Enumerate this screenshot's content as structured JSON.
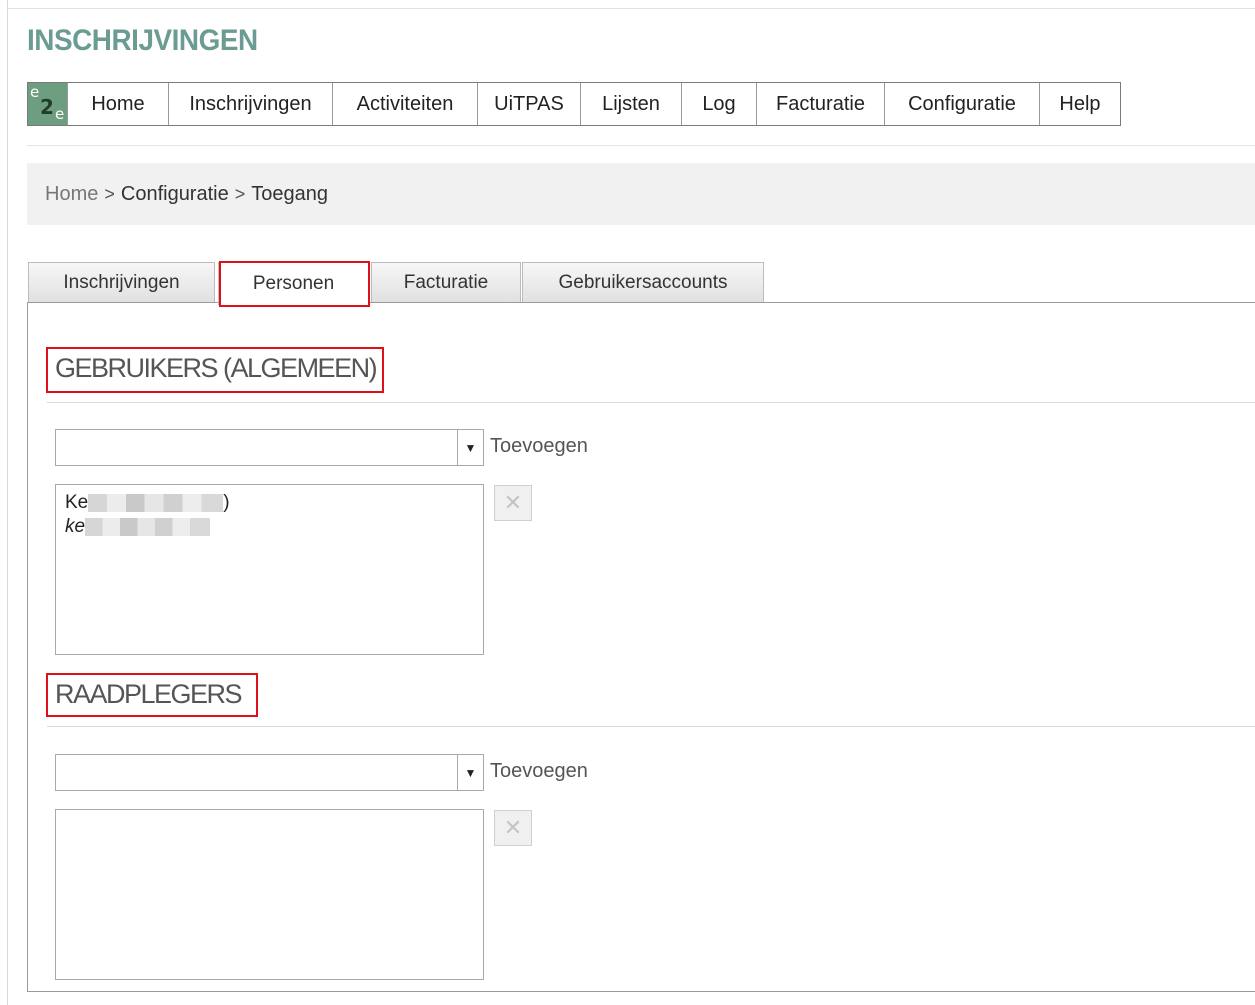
{
  "app": {
    "title": "INSCHRIJVINGEN"
  },
  "menu": {
    "logo_text": [
      "e",
      "2",
      "e"
    ],
    "items": [
      "Home",
      "Inschrijvingen",
      "Activiteiten",
      "UiTPAS",
      "Lijsten",
      "Log",
      "Facturatie",
      "Configuratie",
      "Help"
    ]
  },
  "breadcrumb": {
    "items": [
      "Home",
      "Configuratie",
      "Toegang"
    ],
    "separator": ">"
  },
  "tabs": {
    "items": [
      "Inschrijvingen",
      "Personen",
      "Facturatie",
      "Gebruikersaccounts"
    ],
    "active": "Personen"
  },
  "sections": [
    {
      "title": "GEBRUIKERS (ALGEMEEN)",
      "select_value": "",
      "add_label": "Toevoegen",
      "entries": [
        {
          "name_visible_start": "Ke",
          "name_visible_end": ")",
          "email_visible_start": "ke"
        }
      ],
      "delete_glyph": "✕"
    },
    {
      "title": "RAADPLEGERS",
      "select_value": "",
      "add_label": "Toevoegen",
      "entries": [],
      "delete_glyph": "✕"
    }
  ],
  "colors": {
    "title_green": "#6b9b92",
    "logo_green": "#6e9e80",
    "highlight_red": "#e0101a",
    "breadcrumb_bg": "#f1f1f1"
  },
  "icons": {
    "dropdown": "caret-down-icon",
    "delete": "close-icon"
  }
}
